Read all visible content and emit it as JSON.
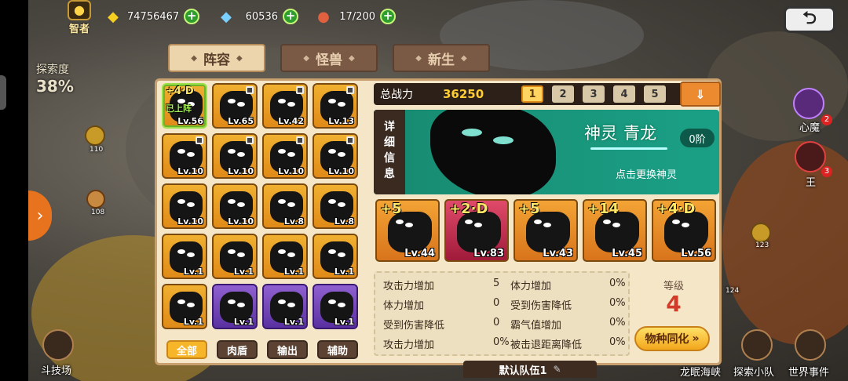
{
  "hud": {
    "title_label": "智者",
    "gold": {
      "value": "74756467",
      "icon": "gold-gem-icon"
    },
    "diamonds": {
      "value": "60536",
      "icon": "diamond-icon"
    },
    "stamina": {
      "value": "17/200",
      "icon": "meat-icon"
    },
    "back_icon": "back-arrow-icon"
  },
  "map": {
    "exploration_label": "探索度",
    "exploration_pct": "38%",
    "node_labels": [
      "110",
      "108",
      "123",
      "124"
    ],
    "right_labels": {
      "heart_demon": "心魔",
      "king": "王",
      "king_badge": "3",
      "heart_badge": "2"
    },
    "bottom_labels": [
      "斗技场",
      "龙眠海峡",
      "探索小队",
      "世界事件"
    ]
  },
  "tabs": [
    {
      "label": "阵容",
      "active": true
    },
    {
      "label": "怪兽",
      "active": false
    },
    {
      "label": "新生",
      "active": false
    }
  ],
  "roster": [
    {
      "level": "Lv.56",
      "plus": "+4·D",
      "on_team": "已上阵",
      "locked": false,
      "color": "orange",
      "selected": true
    },
    {
      "level": "Lv.65",
      "locked": true,
      "color": "orange"
    },
    {
      "level": "Lv.42",
      "locked": true,
      "color": "orange"
    },
    {
      "level": "Lv.13",
      "locked": true,
      "color": "orange"
    },
    {
      "level": "Lv.10",
      "locked": true,
      "color": "orange"
    },
    {
      "level": "Lv.10",
      "locked": true,
      "color": "orange"
    },
    {
      "level": "Lv.10",
      "locked": true,
      "color": "orange"
    },
    {
      "level": "Lv.10",
      "locked": true,
      "color": "orange"
    },
    {
      "level": "Lv.10",
      "locked": false,
      "color": "orange"
    },
    {
      "level": "Lv.10",
      "locked": false,
      "color": "orange"
    },
    {
      "level": "Lv.8",
      "locked": false,
      "color": "orange"
    },
    {
      "level": "Lv.8",
      "locked": false,
      "color": "orange"
    },
    {
      "level": "Lv.1",
      "locked": false,
      "color": "orange"
    },
    {
      "level": "Lv.1",
      "locked": false,
      "color": "orange"
    },
    {
      "level": "Lv.1",
      "locked": false,
      "color": "orange"
    },
    {
      "level": "Lv.1",
      "locked": false,
      "color": "orange"
    },
    {
      "level": "Lv.1",
      "locked": false,
      "color": "orange"
    },
    {
      "level": "Lv.1",
      "locked": false,
      "color": "purple"
    },
    {
      "level": "Lv.1",
      "locked": false,
      "color": "purple"
    },
    {
      "level": "Lv.1",
      "locked": false,
      "color": "purple"
    }
  ],
  "filters": [
    {
      "label": "全部",
      "active": true
    },
    {
      "label": "肉盾",
      "active": false
    },
    {
      "label": "输出",
      "active": false
    },
    {
      "label": "辅助",
      "active": false
    }
  ],
  "power": {
    "label": "总战力",
    "value": "36250"
  },
  "teams": [
    {
      "label": "1",
      "active": true
    },
    {
      "label": "2",
      "active": false
    },
    {
      "label": "3",
      "active": false
    },
    {
      "label": "4",
      "active": false
    },
    {
      "label": "5",
      "active": false
    }
  ],
  "spirit": {
    "detail_tab": "详细信息",
    "detail_chars": [
      "详",
      "细",
      "信",
      "息"
    ],
    "type": "神灵",
    "name": "青龙",
    "stage": "0阶",
    "change_hint": "点击更换神灵"
  },
  "slots": [
    {
      "plus": "+5",
      "level": "Lv.44",
      "color": "orange"
    },
    {
      "plus": "+2·D",
      "level": "Lv.83",
      "color": "pink"
    },
    {
      "plus": "+5",
      "level": "Lv.43",
      "color": "orange"
    },
    {
      "plus": "+14",
      "level": "Lv.45",
      "color": "orange"
    },
    {
      "plus": "+4·D",
      "level": "Lv.56",
      "color": "orange"
    }
  ],
  "stats": [
    {
      "l_label": "攻击力增加",
      "l_value": "5",
      "r_label": "体力增加",
      "r_value": "0%"
    },
    {
      "l_label": "体力增加",
      "l_value": "0",
      "r_label": "受到伤害降低",
      "r_value": "0%"
    },
    {
      "l_label": "受到伤害降低",
      "l_value": "0",
      "r_label": "霸气值增加",
      "r_value": "0%"
    },
    {
      "l_label": "攻击力增加",
      "l_value": "0%",
      "r_label": "被击退距离降低",
      "r_value": "0%"
    }
  ],
  "level_box": {
    "label": "等级",
    "value": "4"
  },
  "sync_button": "物种同化",
  "team_name": "默认队伍1",
  "colors": {
    "accent": "#f7b52a",
    "panel": "#f4e6c6",
    "banner": "#1aa086",
    "level_red": "#d23a2a",
    "power_yellow": "#ffcc33"
  }
}
